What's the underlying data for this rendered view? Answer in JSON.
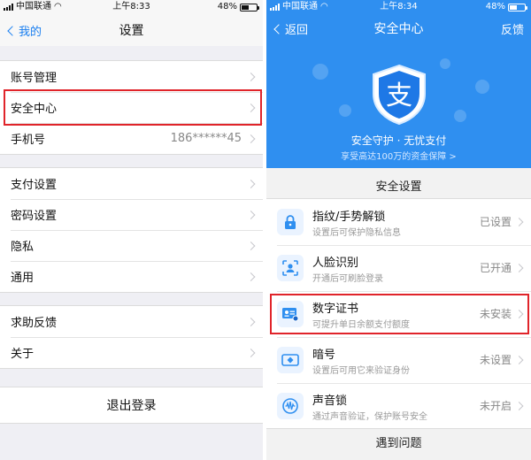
{
  "left": {
    "status": {
      "carrier": "中国联通",
      "time": "上午8:33",
      "battery": "48%",
      "battery_level": 0.48
    },
    "nav": {
      "back": "我的",
      "title": "设置"
    },
    "group1": [
      {
        "label": "账号管理",
        "value": ""
      },
      {
        "label": "安全中心",
        "value": ""
      },
      {
        "label": "手机号",
        "value": "186******45"
      }
    ],
    "group2": [
      {
        "label": "支付设置"
      },
      {
        "label": "密码设置"
      },
      {
        "label": "隐私"
      },
      {
        "label": "通用"
      }
    ],
    "group3": [
      {
        "label": "求助反馈"
      },
      {
        "label": "关于"
      }
    ],
    "logout": "退出登录"
  },
  "right": {
    "status": {
      "carrier": "中国联通",
      "time": "上午8:34",
      "battery": "48%",
      "battery_level": 0.48
    },
    "nav": {
      "back": "返回",
      "title": "安全中心",
      "feedback": "反馈"
    },
    "hero": {
      "logo_char": "支",
      "slogan": "安全守护 · 无忧支付",
      "subslogan": "享受高达100万的资金保障 >"
    },
    "section_title": "安全设置",
    "items": [
      {
        "title": "指纹/手势解锁",
        "sub": "设置后可保护隐私信息",
        "status": "已设置",
        "icon": "lock-icon"
      },
      {
        "title": "人脸识别",
        "sub": "开通后可刷脸登录",
        "status": "已开通",
        "icon": "face-id-icon"
      },
      {
        "title": "数字证书",
        "sub": "可提升单日余额支付额度",
        "status": "未安装",
        "icon": "certificate-icon"
      },
      {
        "title": "暗号",
        "sub": "设置后可用它来验证身份",
        "status": "未设置",
        "icon": "passcode-icon"
      },
      {
        "title": "声音锁",
        "sub": "通过声音验证，保护账号安全",
        "status": "未开启",
        "icon": "voice-lock-icon"
      }
    ],
    "issues": "遇到问题",
    "colors": {
      "brand_blue": "#2f8ff0",
      "highlight_red": "#e0242a",
      "ios_blue": "#1a7ff0"
    }
  }
}
